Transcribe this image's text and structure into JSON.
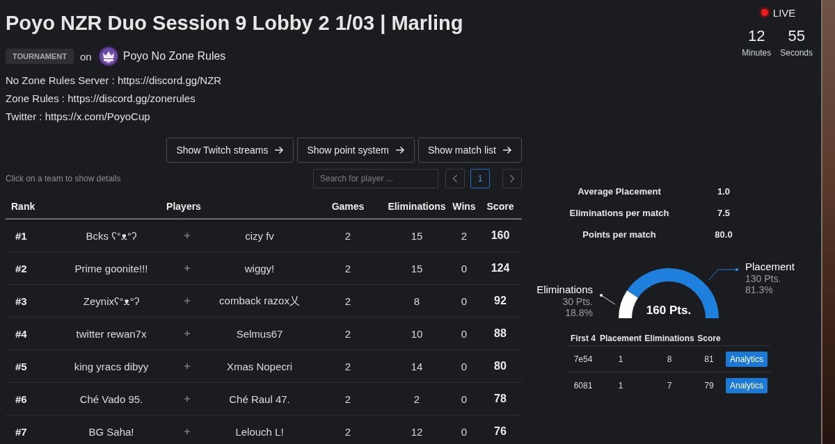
{
  "header": {
    "title": "Poyo NZR Duo Session 9 Lobby 2 1/03 | Marling",
    "tag": "TOURNAMENT",
    "on_text": "on",
    "organizer": "Poyo No Zone Rules"
  },
  "live": {
    "label": "LIVE",
    "timer": [
      {
        "value": "12",
        "unit": "Minutes"
      },
      {
        "value": "55",
        "unit": "Seconds"
      }
    ]
  },
  "description": [
    "No Zone Rules Server : https://discord.gg/NZR",
    "Zone Rules : https://discord.gg/zonerules",
    "Twitter : https://x.com/PoyoCup"
  ],
  "actions": [
    "Show Twitch streams",
    "Show point system",
    "Show match list"
  ],
  "hint": "Click on a team to show details",
  "search": {
    "placeholder": "Search for player ..."
  },
  "pagination": {
    "pages": [
      {
        "label": "1",
        "selected": true
      }
    ]
  },
  "table": {
    "columns": [
      "Rank",
      "Players",
      "Games",
      "Eliminations",
      "Wins",
      "Score"
    ],
    "rows": [
      {
        "rank": "#1",
        "players": [
          "Bcks ʕ°ᴥ°ʔ",
          "cizy fv"
        ],
        "games": "2",
        "eliminations": "15",
        "wins": "2",
        "score": "160"
      },
      {
        "rank": "#2",
        "players": [
          "Prime goonite!!!",
          "wiggy!"
        ],
        "games": "2",
        "eliminations": "15",
        "wins": "0",
        "score": "124"
      },
      {
        "rank": "#3",
        "players": [
          "Zeynixʕ°ᴥ°ʔ",
          "comback razox乂"
        ],
        "games": "2",
        "eliminations": "8",
        "wins": "0",
        "score": "92"
      },
      {
        "rank": "#4",
        "players": [
          "twitter rewan7x",
          "Selmus67"
        ],
        "games": "2",
        "eliminations": "10",
        "wins": "0",
        "score": "88"
      },
      {
        "rank": "#5",
        "players": [
          "king yracs dibyy",
          "Xmas Nopecri"
        ],
        "games": "2",
        "eliminations": "14",
        "wins": "0",
        "score": "80"
      },
      {
        "rank": "#6",
        "players": [
          "Ché Vado 95.",
          "Ché Raul 47."
        ],
        "games": "2",
        "eliminations": "2",
        "wins": "0",
        "score": "78"
      },
      {
        "rank": "#7",
        "players": [
          "BG Saha!",
          "Lelouch L!"
        ],
        "games": "2",
        "eliminations": "12",
        "wins": "0",
        "score": "76"
      }
    ]
  },
  "stats": [
    {
      "label": "Average Placement",
      "value": "1.0"
    },
    {
      "label": "Eliminations per match",
      "value": "7.5"
    },
    {
      "label": "Points per match",
      "value": "80.0"
    }
  ],
  "gauge": {
    "total": "160 Pts.",
    "chart_data": {
      "type": "donut",
      "categories": [
        "Eliminations",
        "Placement"
      ],
      "values": [
        18.8,
        81.3
      ]
    },
    "legend": [
      {
        "points": "30 Pts.",
        "percent": "18.8%",
        "color": "#ffffff"
      },
      {
        "points": "130 Pts.",
        "percent": "81.3%",
        "color": "#1f7fdc"
      }
    ]
  },
  "matches": {
    "columns": [
      "First 4",
      "Placement",
      "Eliminations",
      "Score"
    ],
    "rows": [
      {
        "id": "7e54",
        "placement": "1",
        "eliminations": "8",
        "score": "81",
        "action": "Analytics"
      },
      {
        "id": "6081",
        "placement": "1",
        "eliminations": "7",
        "score": "79",
        "action": "Analytics"
      }
    ]
  }
}
